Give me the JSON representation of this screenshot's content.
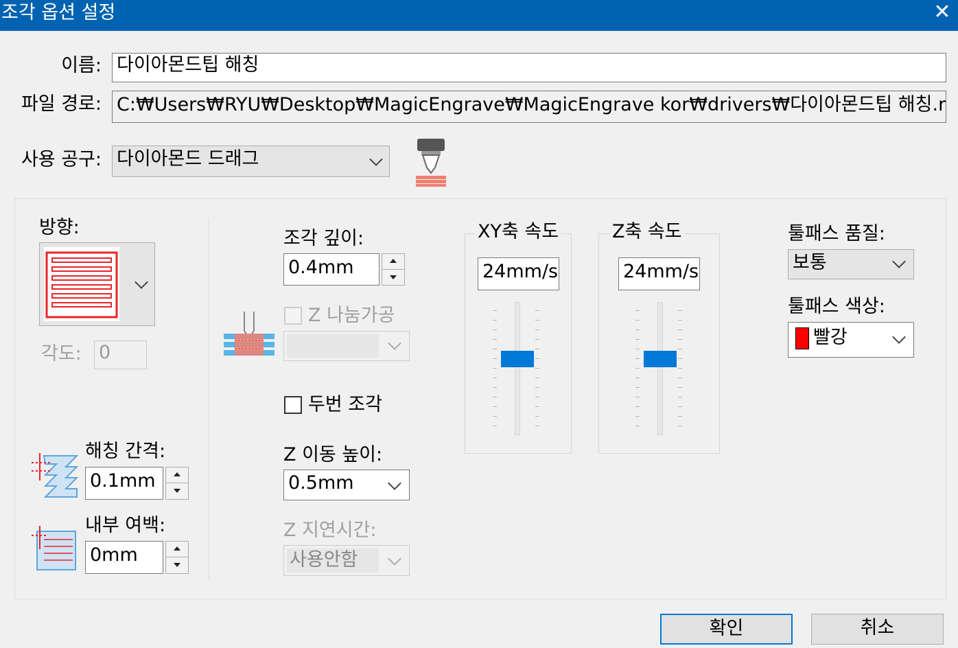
{
  "window": {
    "title": "조각 옵션 설정",
    "close_glyph": "✕"
  },
  "form": {
    "name_label": "이름:",
    "name_value": "다이아몬드팁 해칭",
    "path_label": "파일 경로:",
    "path_value": "C:₩Users₩RYU₩Desktop₩MagicEngrave₩MagicEngrave kor₩drivers₩다이아몬드팁 해칭.ma",
    "tool_label": "사용 공구:",
    "tool_value": "다이아몬드 드래그"
  },
  "direction": {
    "label": "방향:",
    "angle_label": "각도:",
    "angle_value": "0"
  },
  "hatch": {
    "spacing_label": "해칭 간격:",
    "spacing_value": "0.1mm",
    "margin_label": "내부 여백:",
    "margin_value": "0mm"
  },
  "depth": {
    "label": "조각 깊이:",
    "value": "0.4mm",
    "z_split_label": "Z 나눔가공",
    "double_label": "두번 조각",
    "z_move_label": "Z 이동 높이:",
    "z_move_value": "0.5mm",
    "z_delay_label": "Z 지연시간:",
    "z_delay_value": "사용안함"
  },
  "speed": {
    "xy_label": "XY축 속도",
    "xy_value": "24mm/s",
    "xy_level": 0.5,
    "z_label": "Z축 속도",
    "z_value": "24mm/s",
    "z_level": 0.5
  },
  "toolpath": {
    "quality_label": "툴패스 품질:",
    "quality_value": "보통",
    "color_label": "툴패스 색상:",
    "color_value": "빨강",
    "swatch_color": "#ff0000"
  },
  "buttons": {
    "ok": "확인",
    "cancel": "취소"
  },
  "colors": {
    "titlebar": "#0063b1",
    "slider_thumb": "#0078d7"
  }
}
